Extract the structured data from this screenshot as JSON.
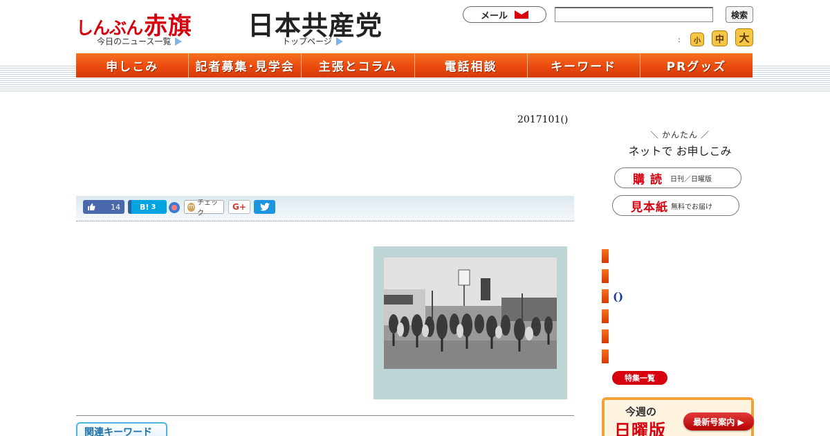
{
  "header": {
    "logo_akahata_kana": "しんぶん",
    "logo_akahata_kanji": "赤旗",
    "todays_news_link": "今日のニュース一覧",
    "logo_jcp": "日本共産党",
    "top_page_link": "トップページ",
    "mail_label": "メール",
    "search_value": "",
    "search_button": "検索",
    "font_size_label": ":",
    "font_sizes": {
      "small": "小",
      "medium": "中",
      "large": "大"
    },
    "brand_color": "#d7000f"
  },
  "nav": {
    "items": [
      "申しこみ",
      "記者募集･見学会",
      "主張とコラム",
      "電話相談",
      "キーワード",
      "PRグッズ"
    ],
    "color": "#ea4a0f"
  },
  "article": {
    "date": "2017101()",
    "share": {
      "facebook_count": "14",
      "hatena_label": "B!",
      "hatena_count": "3",
      "mixi_label": "チェック",
      "gplus_label": "G+"
    },
    "related_keywords_tab": "関連キーワード"
  },
  "sidebar": {
    "net_apply_small": "かんたん",
    "net_apply_big": "ネットで お申しこみ",
    "subscribe_label": "購読",
    "subscribe_note": "日刊／日曜版",
    "sample_label": "見本紙",
    "sample_note": "無料でお届け",
    "bullet_text": "()",
    "feature_list_button": "特集一覧",
    "sunday": {
      "week_label": "今週の",
      "edition_label": "日曜版",
      "latest_button": "最新号案内 ▶"
    }
  }
}
